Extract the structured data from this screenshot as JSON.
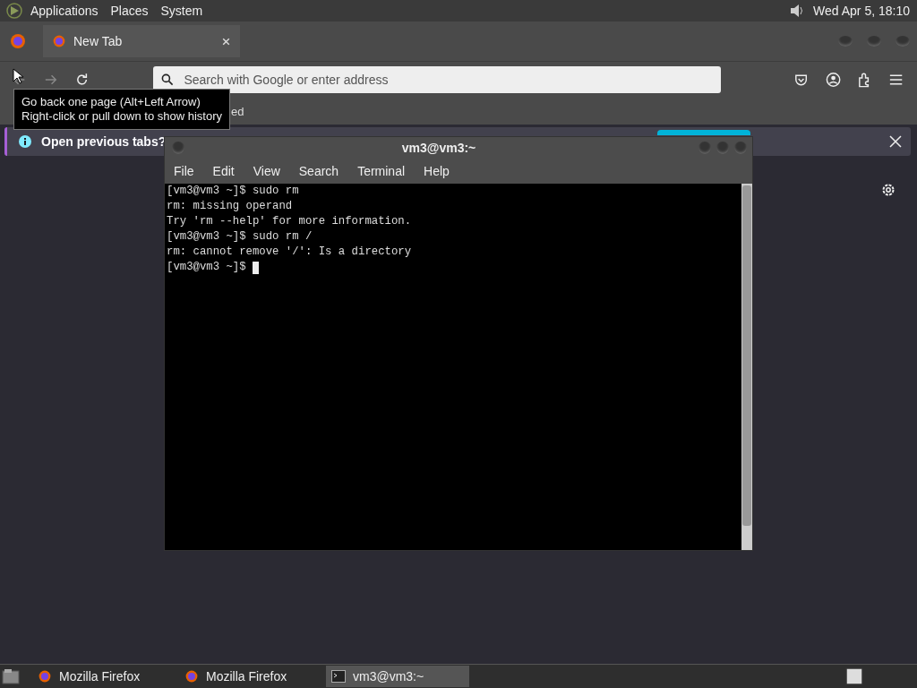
{
  "top_panel": {
    "menus": [
      "Applications",
      "Places",
      "System"
    ],
    "clock": "Wed Apr  5, 18:10"
  },
  "browser": {
    "tabs": [
      {
        "label": "New Tab",
        "selected": true
      }
    ],
    "address": {
      "placeholder": "Search with Google or enter address"
    },
    "bookmark_partial": "ed",
    "notification": {
      "text": "Open previous tabs?"
    },
    "tooltip": {
      "lines": [
        "Go back one page (Alt+Left Arrow)",
        "Right-click or pull down to show history"
      ]
    }
  },
  "terminal": {
    "title": "vm3@vm3:~",
    "menus": [
      "File",
      "Edit",
      "View",
      "Search",
      "Terminal",
      "Help"
    ],
    "lines": [
      "[vm3@vm3 ~]$ sudo rm",
      "rm: missing operand",
      "Try 'rm --help' for more information.",
      "[vm3@vm3 ~]$ sudo rm /",
      "rm: cannot remove '/': Is a directory"
    ],
    "prompt": "[vm3@vm3 ~]$ "
  },
  "taskbar": [
    {
      "label": "Mozilla Firefox",
      "kind": "firefox",
      "selected": false
    },
    {
      "label": "Mozilla Firefox",
      "kind": "firefox",
      "selected": false
    },
    {
      "label": "vm3@vm3:~",
      "kind": "terminal",
      "selected": true
    }
  ]
}
